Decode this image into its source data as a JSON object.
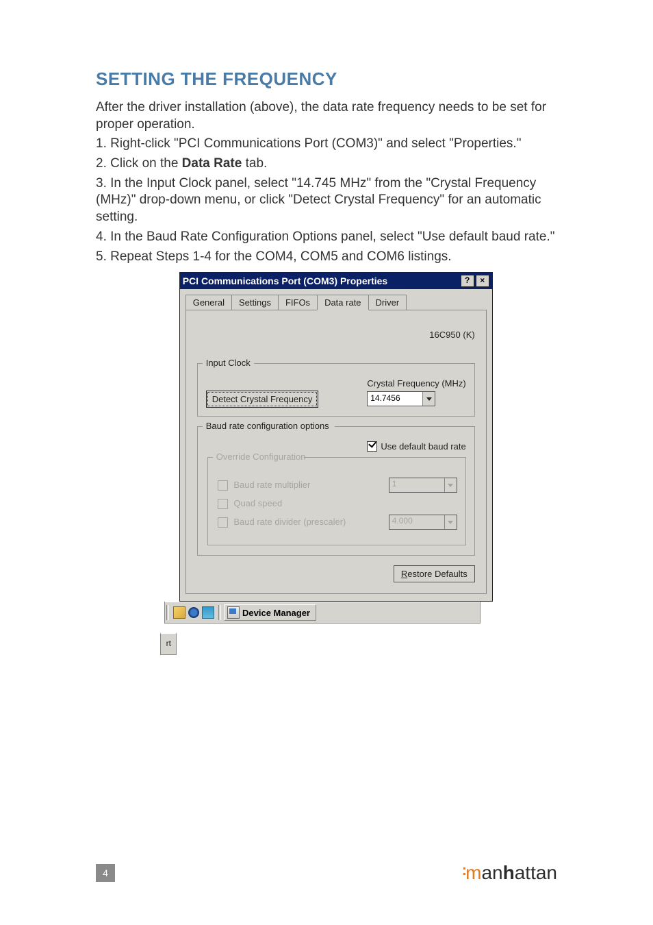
{
  "heading": "SETTING THE FREQUENCY",
  "intro": "After the driver installation (above), the data rate frequency needs to be set for proper operation.",
  "step1": "1. Right-click \"PCI Communications Port (COM3)\" and select \"Properties.\"",
  "step2_pre": "2. Click on the ",
  "step2_bold": "Data Rate",
  "step2_post": " tab.",
  "step3": "3. In the Input Clock panel, select \"14.745 MHz\" from the \"Crystal Frequency (MHz)\" drop-down menu, or click \"Detect Crystal Frequency\" for an automatic setting.",
  "step4": "4. In the Baud Rate Configuration Options panel, select \"Use default baud rate.\"",
  "step5": "5. Repeat Steps 1-4 for the COM4, COM5 and COM6 listings.",
  "dialog": {
    "title": "PCI Communications Port (COM3) Properties",
    "tabs": [
      "General",
      "Settings",
      "FIFOs",
      "Data rate",
      "Driver"
    ],
    "active_tab_index": 3,
    "uart": "16C950 (K)",
    "input_clock": {
      "legend": "Input Clock",
      "detect_btn": "Detect Crystal Frequency",
      "freq_label": "Crystal Frequency (MHz)",
      "freq_value": "14.7456"
    },
    "baud": {
      "legend": "Baud rate configuration options",
      "use_default_label": "Use default baud rate",
      "use_default_checked": true,
      "override": {
        "legend": "Override Configuration",
        "multiplier_label": "Baud rate multiplier",
        "multiplier_value": "1",
        "quad_label": "Quad speed",
        "divider_label": "Baud rate divider (prescaler)",
        "divider_value": "4.000"
      }
    },
    "restore_btn": "Restore Defaults"
  },
  "taskbar": {
    "rt": "rt",
    "devmgr": "Device Manager"
  },
  "page_number": "4",
  "brand": "manhattan"
}
